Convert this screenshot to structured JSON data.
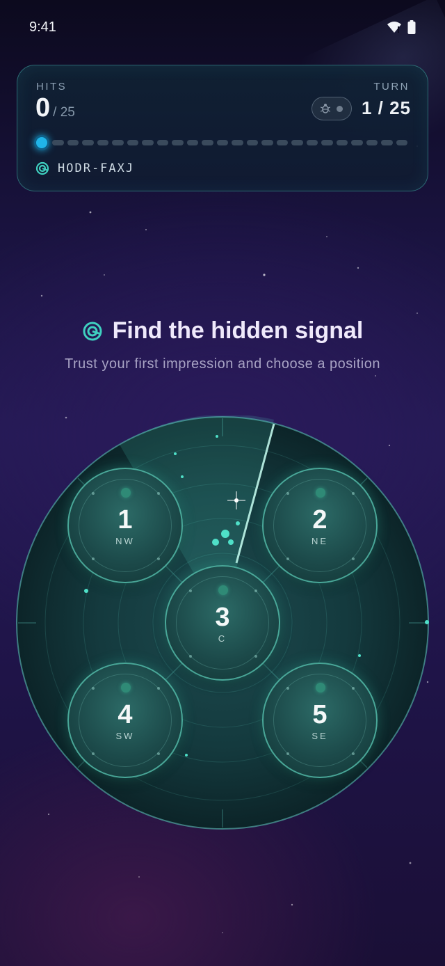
{
  "status_bar": {
    "time": "9:41",
    "icons": [
      "wifi-icon",
      "battery-icon"
    ]
  },
  "hud": {
    "hits_label": "HITS",
    "hits_value": "0",
    "hits_total": "/ 25",
    "turn_label": "TURN",
    "turn_value": "1 / 25",
    "debug_toggle_icon": "bug-icon",
    "debug_toggle_on": false,
    "progress": {
      "current": 1,
      "total": 25
    },
    "session_icon": "signal-target-icon",
    "session_code": "HODR-FAXJ"
  },
  "prompt": {
    "icon": "signal-target-icon",
    "title": "Find the hidden signal",
    "subtitle": "Trust your first impression and choose a position"
  },
  "targets": [
    {
      "number": "1",
      "direction": "NW"
    },
    {
      "number": "2",
      "direction": "NE"
    },
    {
      "number": "3",
      "direction": "C"
    },
    {
      "number": "4",
      "direction": "SW"
    },
    {
      "number": "5",
      "direction": "SE"
    }
  ],
  "colors": {
    "accent_teal": "#3fd0c0",
    "progress_marker": "#20b4e8",
    "background_top": "#0c0a1e",
    "background_mid": "#241a55"
  }
}
